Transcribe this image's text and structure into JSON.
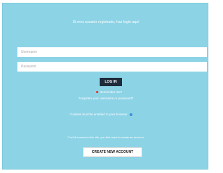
{
  "login": {
    "heading": "Si eres usuario registrado, haz login aquí",
    "username_placeholder": "Username",
    "password_placeholder": "Password",
    "login_button": "LOG IN",
    "remember_label": "Remember me?",
    "forgot_link": "Forgotten your username or password?",
    "cookies_note": "Cookies must be enabled in your browser",
    "register_info": "For full access to this site, you first need to create an account.",
    "create_account_button": "CREATE NEW ACCOUNT"
  },
  "colors": {
    "panel_background": "#8dd3e6",
    "login_button": "#1d2b3a",
    "remember_checkbox": "#e53935",
    "info_icon": "#3c8fd6"
  },
  "icons": {
    "remember": "checkbox-icon",
    "cookies": "help-icon"
  }
}
